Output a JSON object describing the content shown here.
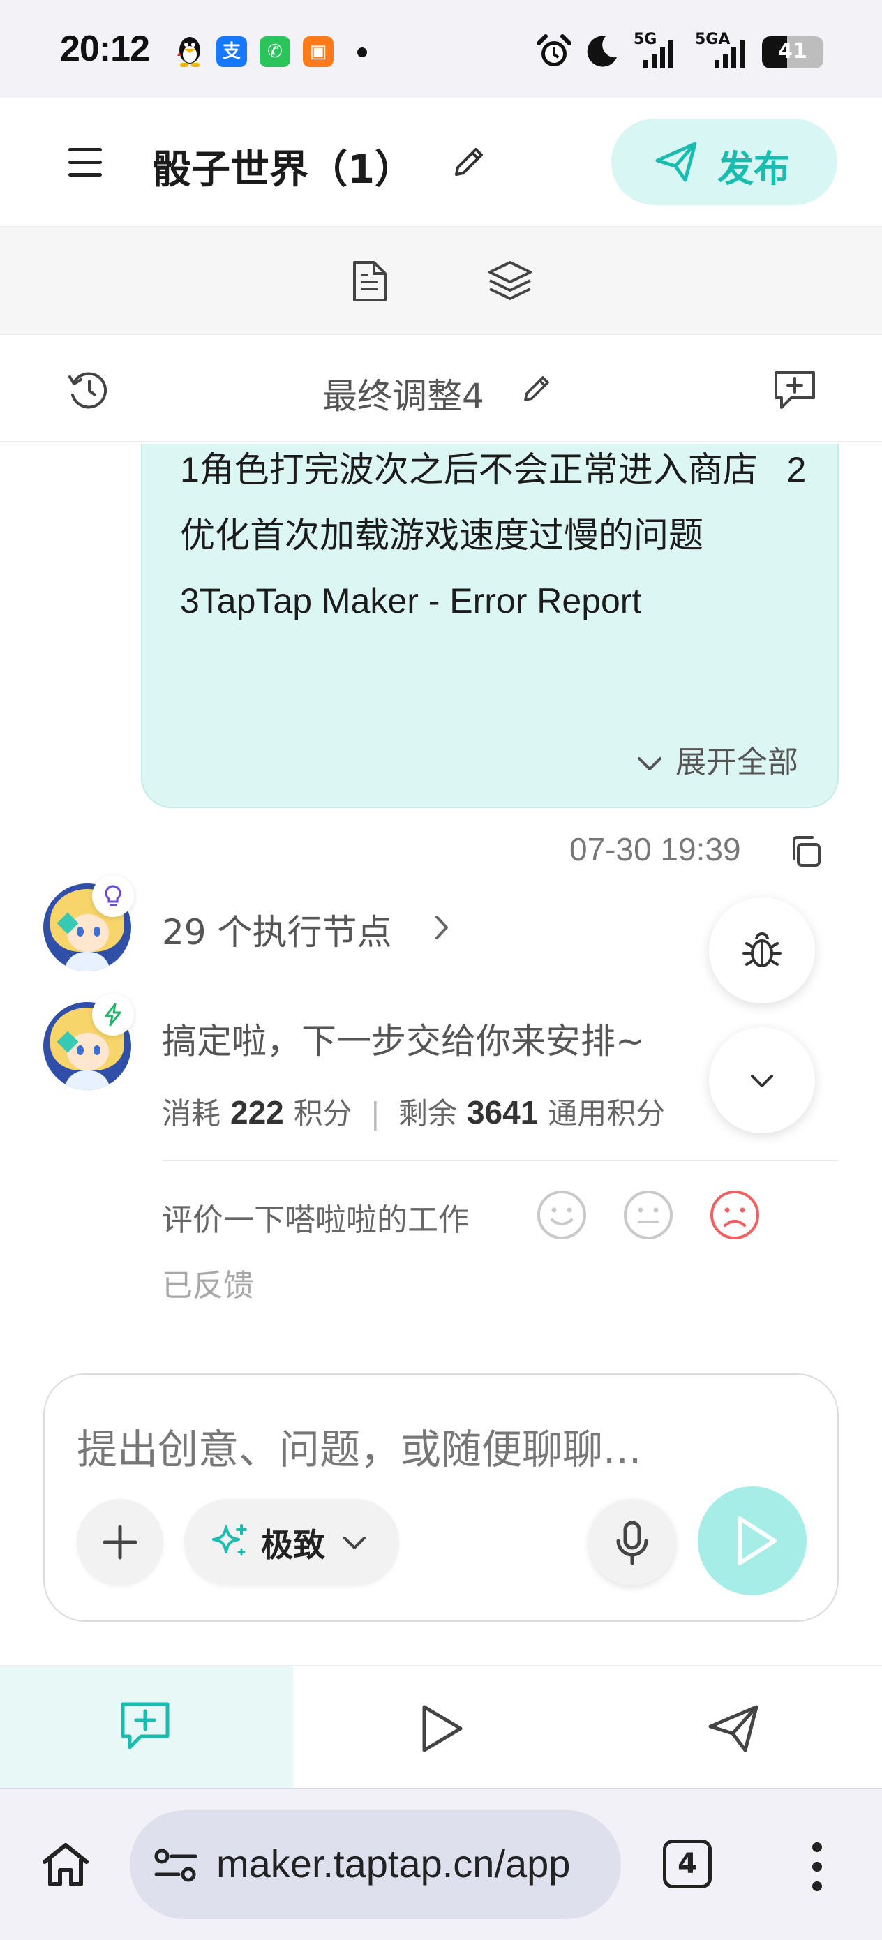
{
  "status_bar": {
    "time": "20:12",
    "apps": [
      {
        "icon": "qq-penguin-icon",
        "color": "#111111"
      },
      {
        "icon": "alipay-icon",
        "glyph": "支",
        "color": "#1677ff"
      },
      {
        "icon": "phone-app-icon",
        "glyph": "✆",
        "color": "#2bc45a"
      },
      {
        "icon": "gift-app-icon",
        "glyph": "▣",
        "color": "#ff7a1a"
      }
    ],
    "network_1": "5G",
    "network_2": "5GA",
    "battery": "41",
    "battery_level": 0.41
  },
  "header": {
    "title": "骰子世界（1）",
    "publish_label": "发布",
    "accent": "#19bdb0"
  },
  "version_bar": {
    "label": "最终调整4"
  },
  "message": {
    "text": "1角色打完波次之后不会正常进入商店   2优化首次加载游戏速度过慢的问题   3TapTap Maker - Error Report",
    "expand_label": "展开全部",
    "timestamp": "07-30 19:39"
  },
  "assistant": {
    "nodes_label": "29 个执行节点",
    "done_text": "搞定啦，下一步交给你来安排~",
    "cost_prefix": "消耗",
    "cost_value": "222",
    "cost_unit": "积分",
    "remaining_prefix": "剩余",
    "remaining_value": "3641",
    "remaining_unit": "通用积分",
    "rate_label": "评价一下嗒啦啦的工作",
    "feedback_label": "已反馈",
    "selected_rating": "sad",
    "rating_color_selected": "#f06060"
  },
  "composer": {
    "placeholder": "提出创意、问题，或随便聊聊...",
    "mode_label": "极致"
  },
  "browser": {
    "url": "maker.taptap.cn/app",
    "tab_count": "4"
  }
}
